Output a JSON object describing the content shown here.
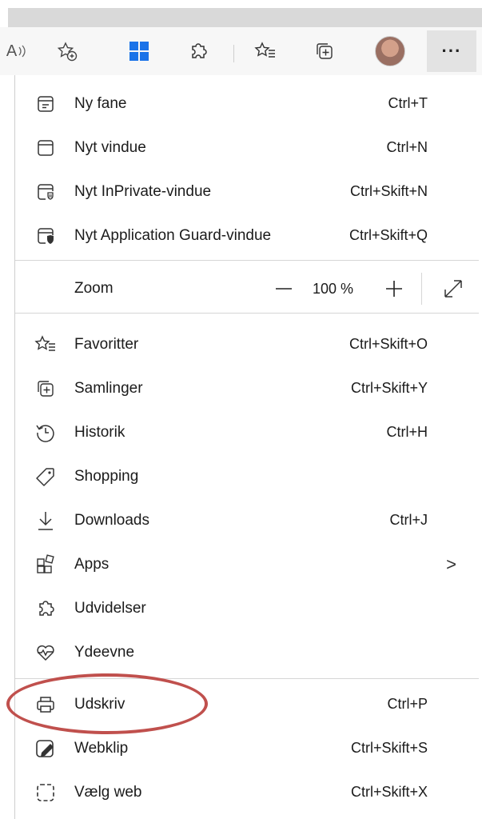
{
  "toolbar": {
    "read_aloud_label": "A",
    "more_label": "···"
  },
  "menu": {
    "group1": [
      {
        "icon": "new-tab-icon",
        "label": "Ny fane",
        "shortcut": "Ctrl+T"
      },
      {
        "icon": "new-window-icon",
        "label": "Nyt vindue",
        "shortcut": "Ctrl+N"
      },
      {
        "icon": "inprivate-window-icon",
        "label": "Nyt InPrivate-vindue",
        "shortcut": "Ctrl+Skift+N"
      },
      {
        "icon": "application-guard-icon",
        "label": "Nyt Application Guard-vindue",
        "shortcut": "Ctrl+Skift+Q"
      }
    ],
    "zoom": {
      "label": "Zoom",
      "minus": "—",
      "value": "100 %",
      "plus": "+"
    },
    "group2": [
      {
        "icon": "favorites-icon",
        "label": "Favoritter",
        "shortcut": "Ctrl+Skift+O"
      },
      {
        "icon": "collections-icon",
        "label": "Samlinger",
        "shortcut": "Ctrl+Skift+Y"
      },
      {
        "icon": "history-icon",
        "label": "Historik",
        "shortcut": "Ctrl+H"
      },
      {
        "icon": "shopping-tag-icon",
        "label": "Shopping",
        "shortcut": ""
      },
      {
        "icon": "download-icon",
        "label": "Downloads",
        "shortcut": "Ctrl+J"
      },
      {
        "icon": "apps-icon",
        "label": "Apps",
        "shortcut": "",
        "chevron": ">"
      },
      {
        "icon": "extensions-icon",
        "label": "Udvidelser",
        "shortcut": ""
      },
      {
        "icon": "performance-icon",
        "label": "Ydeevne",
        "shortcut": ""
      }
    ],
    "group3": [
      {
        "icon": "print-icon",
        "label": "Udskriv",
        "shortcut": "Ctrl+P"
      },
      {
        "icon": "web-capture-icon",
        "label": "Webklip",
        "shortcut": "Ctrl+Skift+S"
      },
      {
        "icon": "web-select-icon",
        "label": "Vælg web",
        "shortcut": "Ctrl+Skift+X"
      }
    ]
  },
  "colors": {
    "highlight": "#c0504d",
    "toolbar_bg": "#f7f7f7",
    "more_btn_bg": "#e3e3e3"
  }
}
